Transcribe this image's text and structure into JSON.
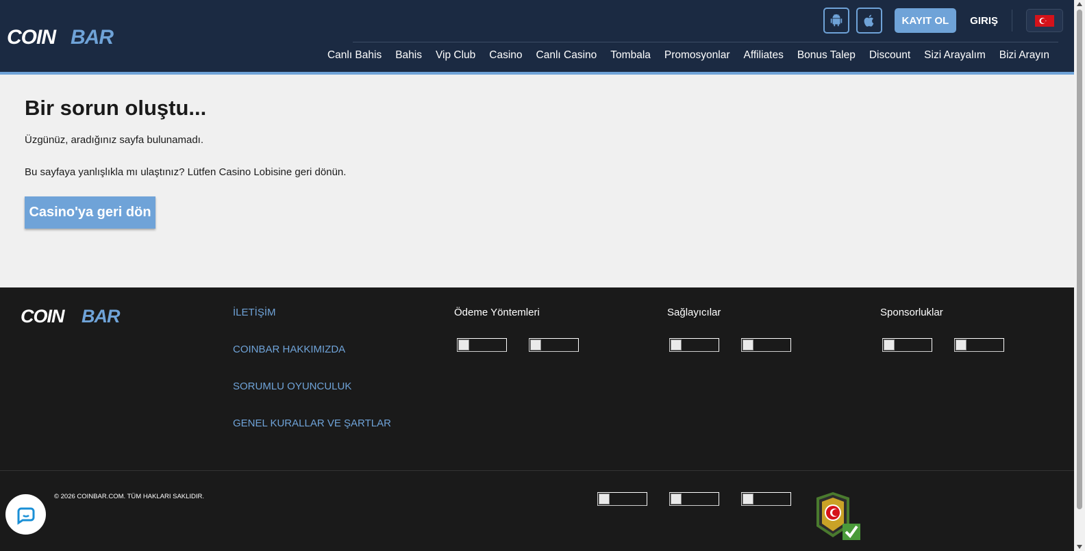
{
  "brand": {
    "name": "COINBAR"
  },
  "header": {
    "register_label": "KAYIT OL",
    "login_label": "GIRIŞ",
    "app_buttons": [
      "android-icon",
      "apple-icon"
    ],
    "language_flag": "turkey-flag-icon",
    "nav": [
      "Canlı Bahis",
      "Bahis",
      "Vip Club",
      "Casino",
      "Canlı Casino",
      "Tombala",
      "Promosyonlar",
      "Affiliates",
      "Bonus Talep",
      "Discount",
      "Sizi Arayalım",
      "Bizi Arayın"
    ]
  },
  "main": {
    "title": "Bir sorun oluştu...",
    "message1": "Üzgünüz, aradığınız sayfa bulunamadı.",
    "message2": "Bu sayfaya yanlışlıkla mı ulaştınız? Lütfen Casino Lobisine geri dönün.",
    "back_button": "Casino'ya geri dön"
  },
  "footer": {
    "links": [
      "İLETİŞİM",
      "COINBAR HAKKIMIZDA",
      "SORUMLU OYUNCULUK",
      "GENEL KURALLAR VE ŞARTLAR"
    ],
    "payment_title": "Ödeme Yöntemleri",
    "providers_title": "Sağlayıcılar",
    "sponsors_title": "Sponsorluklar",
    "copyright": "© 2026 COINBAR.COM. TÜM HAKLARI SAKLIDIR."
  },
  "colors": {
    "header_bg": "#1b2a42",
    "accent": "#6fa3d8",
    "page_bg": "#f0f0f0",
    "footer_bg": "#1a1a1a"
  }
}
